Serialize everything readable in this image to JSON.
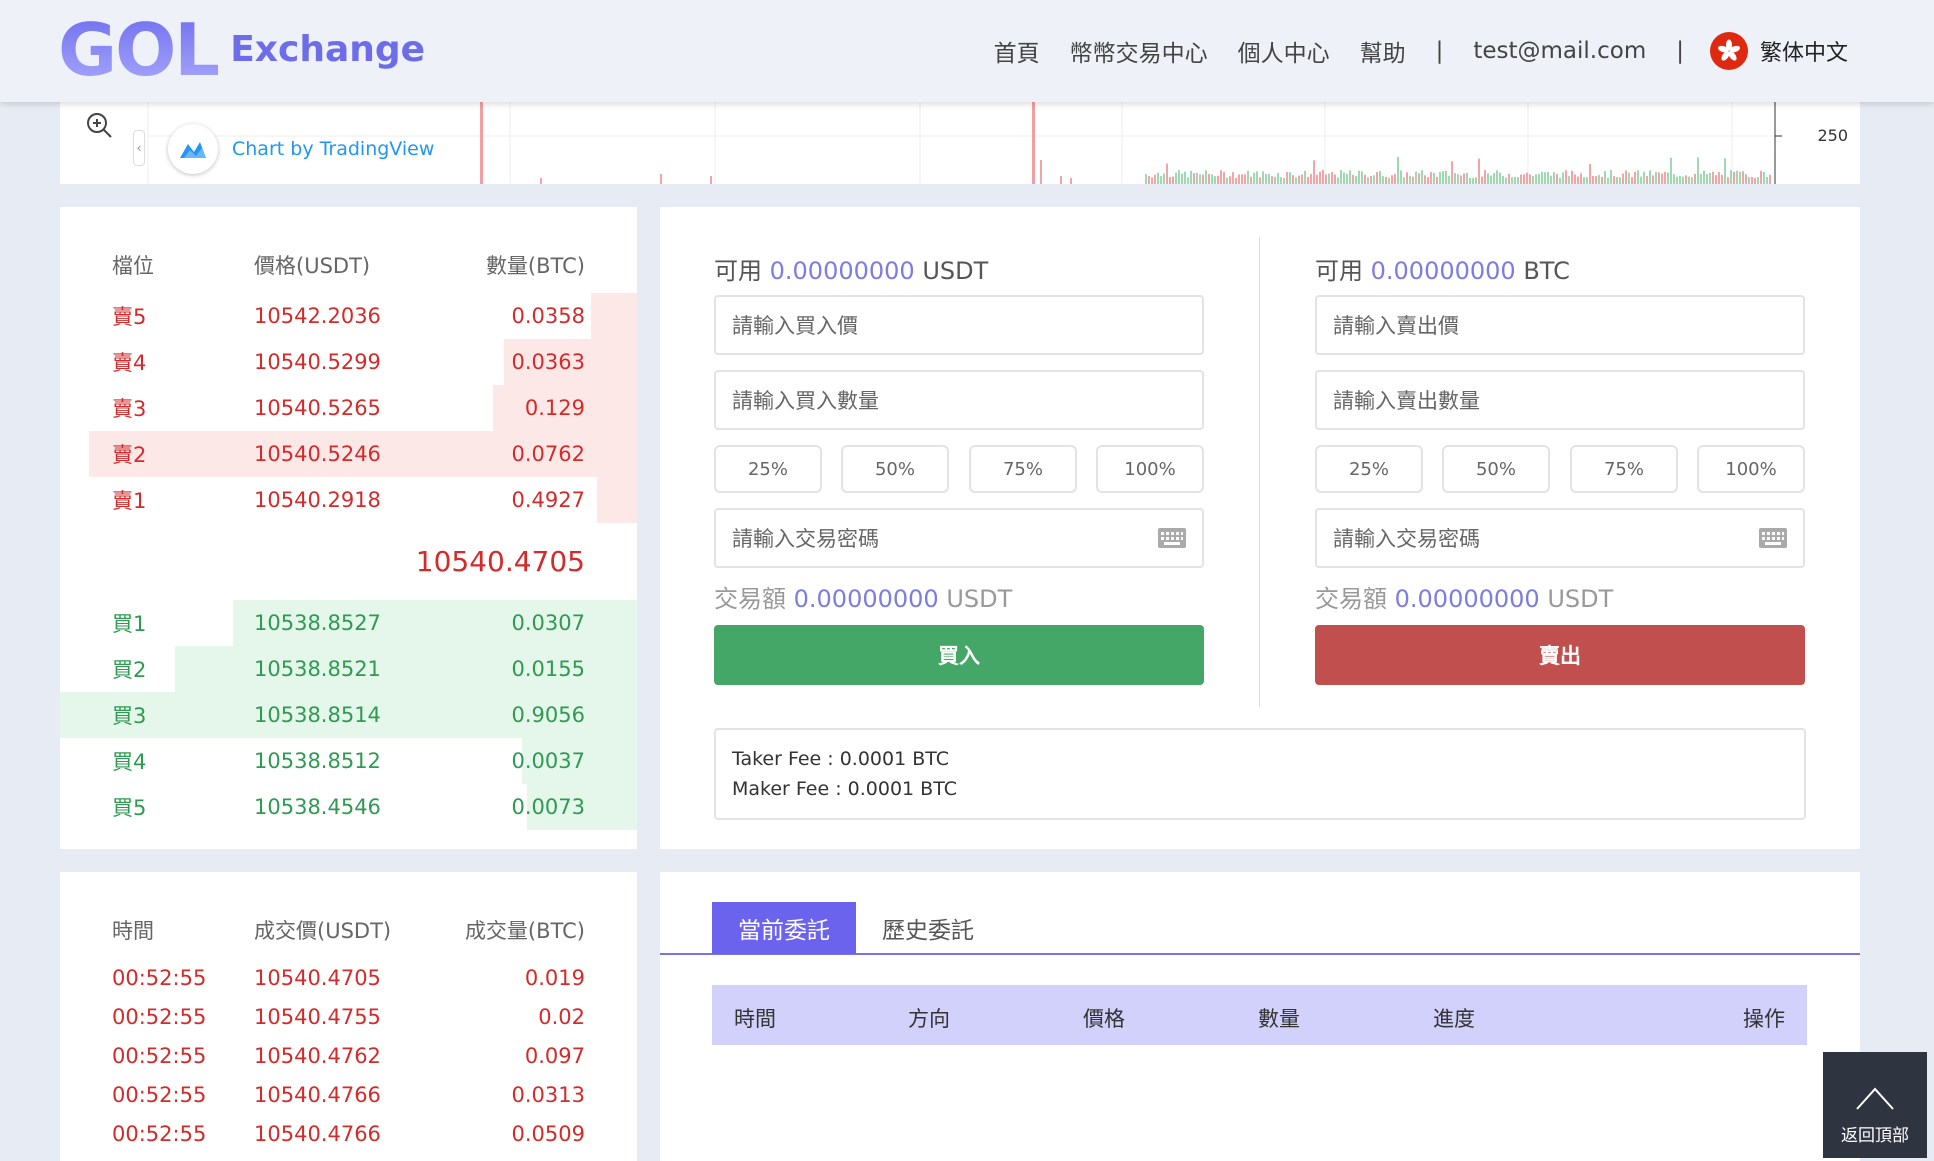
{
  "header": {
    "logo_mark": "GOL",
    "logo_text": "Exchange",
    "nav": [
      "首頁",
      "幣幣交易中心",
      "個人中心",
      "幫助"
    ],
    "separator": "|",
    "email": "test@mail.com",
    "language": "繁体中文"
  },
  "chart": {
    "tv_label": "Chart by TradingView",
    "axis_value": "250"
  },
  "orderbook": {
    "headers": [
      "檔位",
      "價格(USDT)",
      "數量(BTC)"
    ],
    "sells": [
      {
        "label": "賣5",
        "price": "10542.2036",
        "qty": "0.0358",
        "depth": 0.08
      },
      {
        "label": "賣4",
        "price": "10540.5299",
        "qty": "0.0363",
        "depth": 0.23
      },
      {
        "label": "賣3",
        "price": "10540.5265",
        "qty": "0.129",
        "depth": 0.25
      },
      {
        "label": "賣2",
        "price": "10540.5246",
        "qty": "0.0762",
        "depth": 0.95
      },
      {
        "label": "賣1",
        "price": "10540.2918",
        "qty": "0.4927",
        "depth": 0.07
      }
    ],
    "last_price": "10540.4705",
    "buys": [
      {
        "label": "買1",
        "price": "10538.8527",
        "qty": "0.0307",
        "depth": 0.7
      },
      {
        "label": "買2",
        "price": "10538.8521",
        "qty": "0.0155",
        "depth": 0.8
      },
      {
        "label": "買3",
        "price": "10538.8514",
        "qty": "0.9056",
        "depth": 1.0
      },
      {
        "label": "買4",
        "price": "10538.8512",
        "qty": "0.0037",
        "depth": 0.2
      },
      {
        "label": "買5",
        "price": "10538.4546",
        "qty": "0.0073",
        "depth": 0.19
      }
    ]
  },
  "buy_form": {
    "avail_label": "可用",
    "avail_value": "0.00000000",
    "avail_unit": "USDT",
    "price_placeholder": "請輸入買入價",
    "qty_placeholder": "請輸入買入數量",
    "percents": [
      "25%",
      "50%",
      "75%",
      "100%"
    ],
    "password_placeholder": "請輸入交易密碼",
    "amount_label": "交易額",
    "amount_value": "0.00000000",
    "amount_unit": "USDT",
    "button": "買入"
  },
  "sell_form": {
    "avail_label": "可用",
    "avail_value": "0.00000000",
    "avail_unit": "BTC",
    "price_placeholder": "請輸入賣出價",
    "qty_placeholder": "請輸入賣出數量",
    "percents": [
      "25%",
      "50%",
      "75%",
      "100%"
    ],
    "password_placeholder": "請輸入交易密碼",
    "amount_label": "交易額",
    "amount_value": "0.00000000",
    "amount_unit": "USDT",
    "button": "賣出"
  },
  "fees": {
    "taker": "Taker Fee : 0.0001 BTC",
    "maker": "Maker Fee : 0.0001 BTC"
  },
  "trades": {
    "headers": [
      "時間",
      "成交價(USDT)",
      "成交量(BTC)"
    ],
    "rows": [
      {
        "time": "00:52:55",
        "price": "10540.4705",
        "qty": "0.019"
      },
      {
        "time": "00:52:55",
        "price": "10540.4755",
        "qty": "0.02"
      },
      {
        "time": "00:52:55",
        "price": "10540.4762",
        "qty": "0.097"
      },
      {
        "time": "00:52:55",
        "price": "10540.4766",
        "qty": "0.0313"
      },
      {
        "time": "00:52:55",
        "price": "10540.4766",
        "qty": "0.0509"
      }
    ]
  },
  "orders": {
    "tabs": [
      "當前委託",
      "歷史委託"
    ],
    "headers": [
      "時間",
      "方向",
      "價格",
      "數量",
      "進度",
      "操作"
    ]
  },
  "back_top": "返回頂部",
  "colors": {
    "accent": "#6b63ed",
    "sell": "#d32b2b",
    "buy": "#2e9a52",
    "buy_button": "#44a768",
    "sell_button": "#c14f4d"
  }
}
